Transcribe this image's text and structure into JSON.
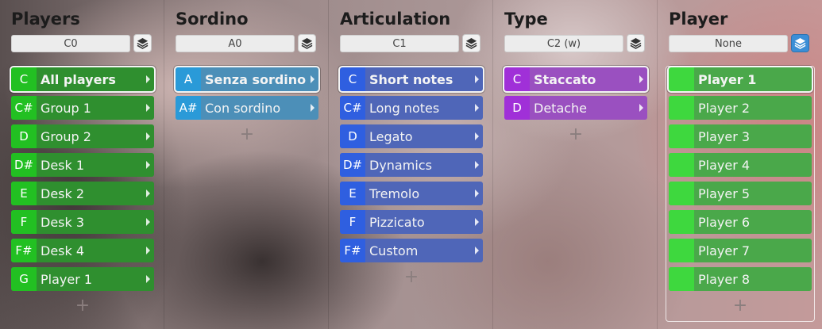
{
  "columns": [
    {
      "title": "Players",
      "note": "C0",
      "layer_active": false,
      "colors": {
        "key": "#22c022",
        "label": "#2f8f2f"
      },
      "items": [
        {
          "key": "C",
          "label": "All players",
          "selected": true
        },
        {
          "key": "C#",
          "label": "Group 1"
        },
        {
          "key": "D",
          "label": "Group 2"
        },
        {
          "key": "D#",
          "label": "Desk 1"
        },
        {
          "key": "E",
          "label": "Desk 2"
        },
        {
          "key": "F",
          "label": "Desk 3"
        },
        {
          "key": "F#",
          "label": "Desk 4"
        },
        {
          "key": "G",
          "label": "Player 1"
        }
      ],
      "add_label": "+"
    },
    {
      "title": "Sordino",
      "note": "A0",
      "layer_active": false,
      "colors": {
        "key": "#2a9ad8",
        "label": "#4c8fb8"
      },
      "items": [
        {
          "key": "A",
          "label": "Senza sordino",
          "selected": true
        },
        {
          "key": "A#",
          "label": "Con sordino"
        }
      ],
      "add_label": "+"
    },
    {
      "title": "Articulation",
      "note": "C1",
      "layer_active": false,
      "colors": {
        "key": "#2f5fe0",
        "label": "#4f66b8"
      },
      "items": [
        {
          "key": "C",
          "label": "Short notes",
          "selected": true
        },
        {
          "key": "C#",
          "label": "Long notes"
        },
        {
          "key": "D",
          "label": "Legato"
        },
        {
          "key": "D#",
          "label": "Dynamics"
        },
        {
          "key": "E",
          "label": "Tremolo"
        },
        {
          "key": "F",
          "label": "Pizzicato"
        },
        {
          "key": "F#",
          "label": "Custom"
        }
      ],
      "add_label": "+"
    },
    {
      "title": "Type",
      "note": "C2 (w)",
      "layer_active": false,
      "colors": {
        "key": "#a030d8",
        "label": "#9a50c0"
      },
      "items": [
        {
          "key": "C",
          "label": "Staccato",
          "selected": true
        },
        {
          "key": "D",
          "label": "Detache"
        }
      ],
      "add_label": "+"
    },
    {
      "title": "Player",
      "note": "None",
      "layer_active": true,
      "colors": {
        "key": "#3ed83e",
        "label": "#4aa84a"
      },
      "items": [
        {
          "key": "",
          "label": "Player 1",
          "selected": true
        },
        {
          "key": "",
          "label": "Player 2"
        },
        {
          "key": "",
          "label": "Player 3"
        },
        {
          "key": "",
          "label": "Player 4"
        },
        {
          "key": "",
          "label": "Player 5"
        },
        {
          "key": "",
          "label": "Player 6"
        },
        {
          "key": "",
          "label": "Player 7"
        },
        {
          "key": "",
          "label": "Player 8"
        }
      ],
      "add_label": "+"
    }
  ]
}
